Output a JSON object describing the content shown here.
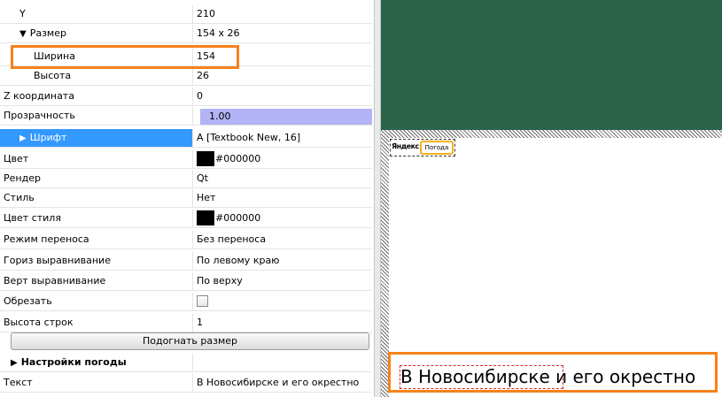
{
  "properties": [
    {
      "id": "y",
      "name": "Y",
      "value": "210",
      "level": 1
    },
    {
      "id": "size",
      "name": "Размер",
      "value": "154 x 26",
      "level": 1,
      "expanded": true
    },
    {
      "id": "width",
      "name": "Ширина",
      "value": "154",
      "level": 2
    },
    {
      "id": "height",
      "name": "Высота",
      "value": "26",
      "level": 2
    },
    {
      "id": "z",
      "name": "Z координата",
      "value": "0",
      "level": 0
    },
    {
      "id": "opacity",
      "name": "Прозрачность",
      "value": "1.00",
      "level": 0
    },
    {
      "id": "font",
      "name": "Шрифт",
      "value": "A [Textbook New, 16]",
      "level": 1,
      "selected": true
    },
    {
      "id": "color",
      "name": "Цвет",
      "value": "#000000",
      "swatch": "#000000",
      "level": 0
    },
    {
      "id": "render",
      "name": "Рендер",
      "value": "Qt",
      "level": 0
    },
    {
      "id": "style",
      "name": "Стиль",
      "value": "Нет",
      "level": 0
    },
    {
      "id": "style-color",
      "name": "Цвет стиля",
      "value": "#000000",
      "swatch": "#000000",
      "level": 0
    },
    {
      "id": "wrap",
      "name": "Режим переноса",
      "value": "Без переноса",
      "level": 0
    },
    {
      "id": "halign",
      "name": "Гориз выравнивание",
      "value": "По левому краю",
      "level": 0
    },
    {
      "id": "valign",
      "name": "Верт выравнивание",
      "value": "По верху",
      "level": 0
    },
    {
      "id": "clip",
      "name": "Обрезать",
      "value": "",
      "checked": false,
      "level": 0
    },
    {
      "id": "line-height",
      "name": "Высота строк",
      "value": "1",
      "level": 0
    }
  ],
  "fit_button_label": "Подогнать размер",
  "weather_section": {
    "label": "Настройки погоды"
  },
  "text_property": {
    "name": "Текст",
    "value": "В Новосибирске и его окрестно"
  },
  "preview": {
    "background_color": "#2a6349",
    "logo_text": "Яндекс",
    "weather_badge": "Погода",
    "rendered_text": "В Новосибирске и его окрестно"
  },
  "colors": {
    "selection": "#3399ff",
    "opacity_bar": "#b3b3f7",
    "highlight": "#f7821b"
  }
}
